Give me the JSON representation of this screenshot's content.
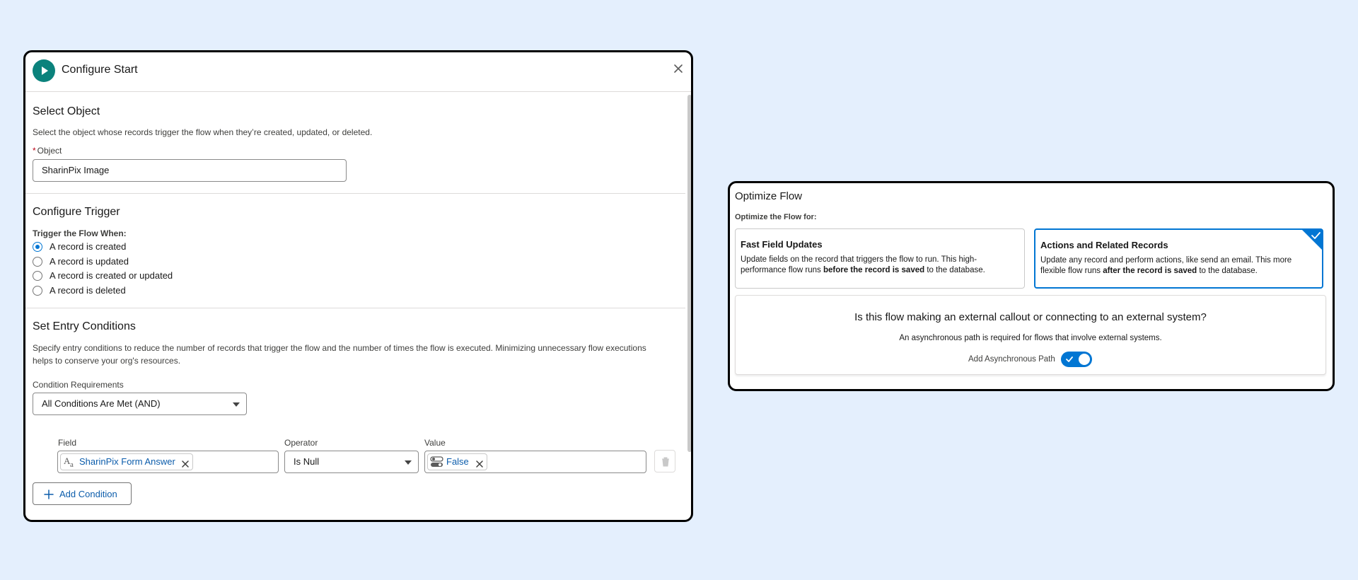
{
  "configure_start": {
    "title": "Configure Start",
    "select_object": {
      "heading": "Select Object",
      "help": "Select the object whose records trigger the flow when they’re created, updated, or deleted.",
      "field_label": "Object",
      "required_marker": "*",
      "value": "SharinPix Image"
    },
    "configure_trigger": {
      "heading": "Configure Trigger",
      "label": "Trigger the Flow When:",
      "options": [
        {
          "label": "A record is created",
          "checked": true
        },
        {
          "label": "A record is updated",
          "checked": false
        },
        {
          "label": "A record is created or updated",
          "checked": false
        },
        {
          "label": "A record is deleted",
          "checked": false
        }
      ]
    },
    "entry_conditions": {
      "heading": "Set Entry Conditions",
      "help": "Specify entry conditions to reduce the number of records that trigger the flow and the number of times the flow is executed. Minimizing unnecessary flow executions helps to conserve your org's resources.",
      "requirement_label": "Condition Requirements",
      "requirement_value": "All Conditions Are Met (AND)",
      "columns": {
        "field": "Field",
        "operator": "Operator",
        "value": "Value"
      },
      "row": {
        "field": "SharinPix Form Answer",
        "operator": "Is Null",
        "value": "False"
      },
      "add_button": "Add Condition"
    }
  },
  "optimize_flow": {
    "title": "Optimize Flow",
    "subtitle": "Optimize the Flow for:",
    "options": [
      {
        "title": "Fast Field Updates",
        "desc_pre": "Update fields on the record that triggers the flow to run. This high-performance flow runs ",
        "desc_bold": "before the record is saved",
        "desc_post": " to the database.",
        "selected": false
      },
      {
        "title": "Actions and Related Records",
        "desc_pre": "Update any record and perform actions, like send an email. This more flexible flow runs ",
        "desc_bold": "after the record is saved",
        "desc_post": " to the database.",
        "selected": true
      }
    ],
    "async": {
      "question": "Is this flow making an external callout or connecting to an external system?",
      "note": "An asynchronous path is required for flows that involve external systems.",
      "toggle_label": "Add Asynchronous Path",
      "enabled": true
    }
  },
  "colors": {
    "background": "#e4effd",
    "brand_blue": "#0176d3",
    "start_icon": "#0b827c",
    "link_blue": "#0b5cab"
  }
}
